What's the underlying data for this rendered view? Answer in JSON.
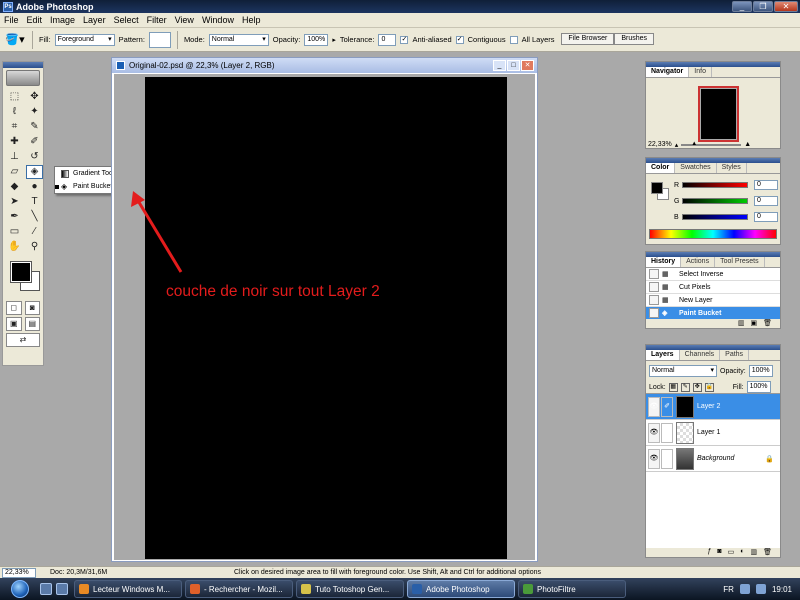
{
  "window": {
    "title": "Adobe Photoshop",
    "app_icon_glyph": "Ps"
  },
  "menu": [
    "File",
    "Edit",
    "Image",
    "Layer",
    "Select",
    "Filter",
    "View",
    "Window",
    "Help"
  ],
  "options": {
    "fill_label": "Fill:",
    "fill_value": "Foreground",
    "pattern_label": "Pattern:",
    "mode_label": "Mode:",
    "mode_value": "Normal",
    "opacity_label": "Opacity:",
    "opacity_value": "100%",
    "tolerance_label": "Tolerance:",
    "tolerance_value": "0",
    "anti_aliased_label": "Anti-aliased",
    "contiguous_label": "Contiguous",
    "all_layers_label": "All Layers",
    "wells": [
      "File Browser",
      "Brushes"
    ]
  },
  "flyout": {
    "items": [
      {
        "label": "Gradient Tool",
        "key": "G",
        "selected": false
      },
      {
        "label": "Paint Bucket Tool",
        "key": "G",
        "selected": true
      }
    ]
  },
  "document": {
    "title": "Original-02.psd @ 22,3% (Layer 2, RGB)"
  },
  "annotation": {
    "text": "couche de noir sur tout Layer 2",
    "color": "#e31c1c"
  },
  "navigator": {
    "tabs": [
      "Navigator",
      "Info"
    ],
    "zoom": "22,33%"
  },
  "color": {
    "tabs": [
      "Color",
      "Swatches",
      "Styles"
    ],
    "channels": [
      {
        "label": "R",
        "value": "0"
      },
      {
        "label": "G",
        "value": "0"
      },
      {
        "label": "B",
        "value": "0"
      }
    ]
  },
  "history": {
    "tabs": [
      "History",
      "Actions",
      "Tool Presets"
    ],
    "items": [
      {
        "label": "Select Inverse",
        "selected": false
      },
      {
        "label": "Cut Pixels",
        "selected": false
      },
      {
        "label": "New Layer",
        "selected": false
      },
      {
        "label": "Paint Bucket",
        "selected": true
      }
    ]
  },
  "layers": {
    "tabs": [
      "Layers",
      "Channels",
      "Paths"
    ],
    "blend_mode": "Normal",
    "opacity_label": "Opacity:",
    "opacity_value": "100%",
    "lock_label": "Lock:",
    "fill_label": "Fill:",
    "fill_value": "100%",
    "items": [
      {
        "name": "Layer 2",
        "selected": true
      },
      {
        "name": "Layer 1",
        "selected": false
      },
      {
        "name": "Background",
        "selected": false,
        "italic": true
      }
    ]
  },
  "status": {
    "zoom": "22,33%",
    "doc": "Doc: 20,3M/31,6M",
    "hint": "Click on desired image area to fill with foreground color.  Use Shift, Alt and Ctrl for additional options"
  },
  "taskbar": {
    "tasks": [
      {
        "label": "Lecteur Windows M...",
        "color": "#e98a24",
        "active": false
      },
      {
        "label": "- Rechercher - Mozil...",
        "color": "#e0602a",
        "active": false
      },
      {
        "label": "Tuto Totoshop Gen...",
        "color": "#d6c24a",
        "active": false
      },
      {
        "label": "Adobe Photoshop",
        "color": "#2a5fa8",
        "active": true
      },
      {
        "label": "PhotoFiltre",
        "color": "#4a9a3a",
        "active": false
      }
    ],
    "lang": "FR",
    "clock": "19:01"
  }
}
